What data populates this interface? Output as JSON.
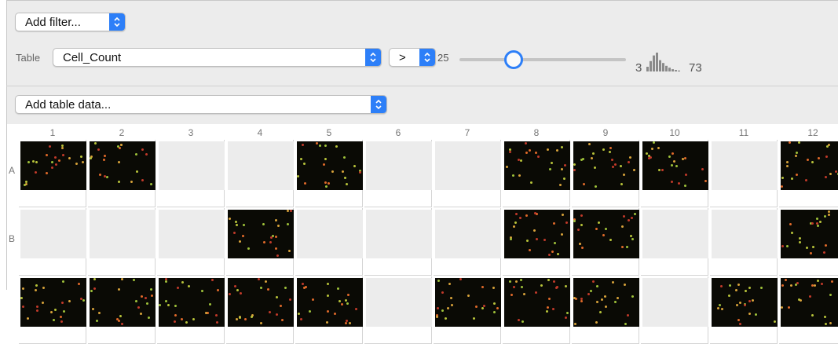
{
  "filter": {
    "add_filter_label": "Add filter..."
  },
  "table_filter": {
    "table_label": "Table",
    "column_value": "Cell_Count",
    "operator_value": ">",
    "threshold": 25,
    "histogram_min": "3",
    "histogram_max": "73",
    "histogram_bars": [
      0.25,
      0.55,
      0.85,
      1.0,
      0.6,
      0.45,
      0.3,
      0.2,
      0.12,
      0.08,
      0.05
    ]
  },
  "table_data": {
    "add_table_data_label": "Add table data..."
  },
  "plate": {
    "columns": [
      "1",
      "2",
      "3",
      "4",
      "5",
      "6",
      "7",
      "8",
      "9",
      "10",
      "11",
      "12"
    ],
    "rows": [
      {
        "label": "A",
        "wells": [
          "image",
          "image",
          "empty",
          "empty",
          "image",
          "empty",
          "empty",
          "image",
          "image",
          "image",
          "empty",
          "image"
        ]
      },
      {
        "label": "B",
        "wells": [
          "empty",
          "empty",
          "empty",
          "image",
          "empty",
          "empty",
          "empty",
          "image",
          "image",
          "empty",
          "empty",
          "image"
        ]
      },
      {
        "label": "",
        "wells": [
          "image",
          "image",
          "image",
          "image",
          "image",
          "empty",
          "image",
          "image",
          "image",
          "empty",
          "image",
          "image"
        ]
      }
    ]
  },
  "colors": {
    "accent": "#2d7ff8",
    "panel": "#ececec",
    "well_empty": "#ececec",
    "well_image": "#0a0a05"
  }
}
